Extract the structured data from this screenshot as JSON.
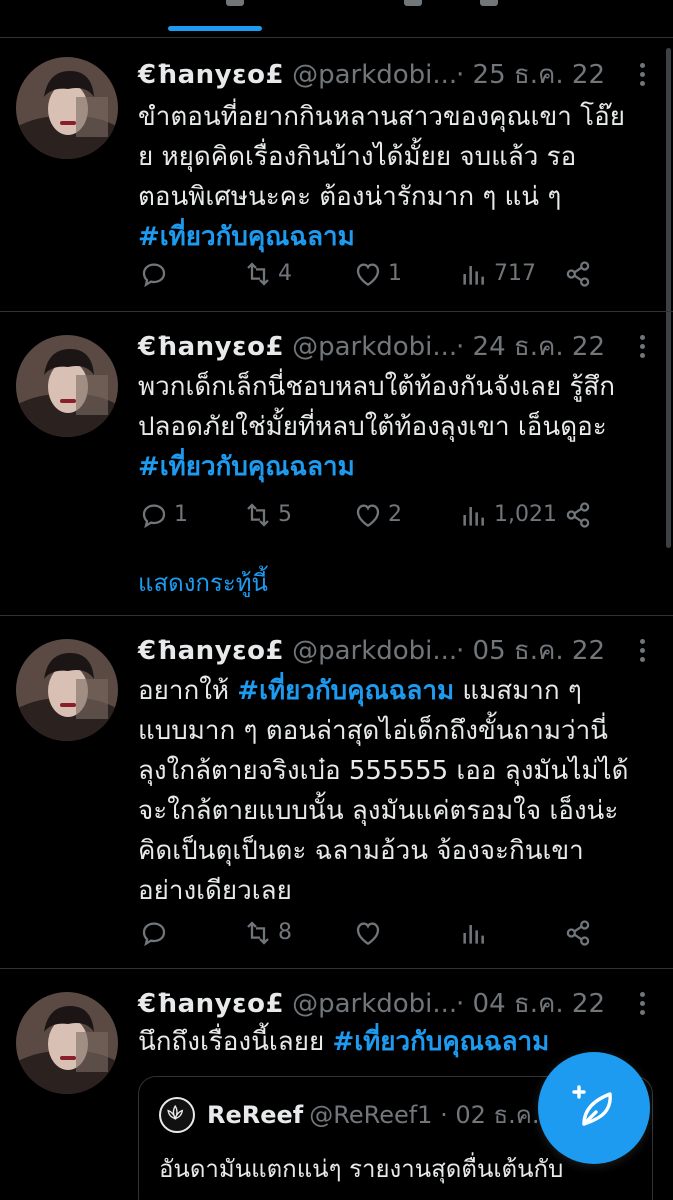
{
  "colors": {
    "background": "#000000",
    "accent": "#1d9bf0",
    "muted": "#71767b",
    "text": "#e7e9ea",
    "divider": "#2f3336"
  },
  "tweets": [
    {
      "name": "€ħanyεo£",
      "handle": "@parkdobi...",
      "date": "· 25 ธ.ค. 22",
      "text": "ขำตอนที่อยากกินหลานสาวของคุณเขา โอ๊ย\nย หยุดคิดเรื่องกินบ้างได้มั้ยย จบแล้ว รอ\nตอนพิเศษนะคะ ต้องน่ารักมาก ๆ แน่ ๆ",
      "hashtag": "#เที่ยวกับคุณฉลาม",
      "replies": "",
      "retweets": "4",
      "likes": "1",
      "views": "717"
    },
    {
      "name": "€ħanyεo£",
      "handle": "@parkdobi...",
      "date": "· 24 ธ.ค. 22",
      "text": "พวกเด็กเล็กนี่ชอบหลบใต้ท้องกันจังเลย รู้สึก\nปลอดภัยใช่มั้ยที่หลบใต้ท้องลุงเขา เอ็นดูอะ",
      "hashtag": "#เที่ยวกับคุณฉลาม",
      "replies": "1",
      "retweets": "5",
      "likes": "2",
      "views": "1,021",
      "show_thread": "แสดงกระทู้นี้"
    },
    {
      "name": "€ħanyεo£",
      "handle": "@parkdobi...",
      "date": "· 05 ธ.ค. 22",
      "text_before": "อยากให้ ",
      "hashtag": "#เที่ยวกับคุณฉลาม",
      "text_after": "  แมสมาก ๆ\nแบบมาก ๆ ตอนล่าสุดไอ่เด็กถึงขั้นถามว่านี่\nลุงใกล้ตายจริงเบ๋อ 555555 เออ ลุงมันไม่ได้\nจะใกล้ตายแบบนั้น ลุงมันแค่ตรอมใจ เอ็งน่ะ\nคิดเป็นตุเป็นตะ ฉลามอ้วน จ้องจะกินเขา\nอย่างเดียวเลย",
      "replies": "",
      "retweets": "8",
      "likes": "",
      "views": ""
    },
    {
      "name": "€ħanyεo£",
      "handle": "@parkdobi...",
      "date": "· 04 ธ.ค. 22",
      "text": "นึกถึงเรื่องนี้เลยย ",
      "hashtag": "#เที่ยวกับคุณฉลาม",
      "quote": {
        "name": "ReReef",
        "handle": "@ReReef1 · 02 ธ.ค.",
        "text": "อันดามันแตกแน่ๆ รายงานสุดตื่นเต้นกับ"
      }
    }
  ],
  "icons": {
    "reply": "reply-icon",
    "retweet": "retweet-icon",
    "like": "heart-icon",
    "views": "analytics-icon",
    "share": "share-icon",
    "more": "more-icon",
    "compose": "compose-icon"
  }
}
